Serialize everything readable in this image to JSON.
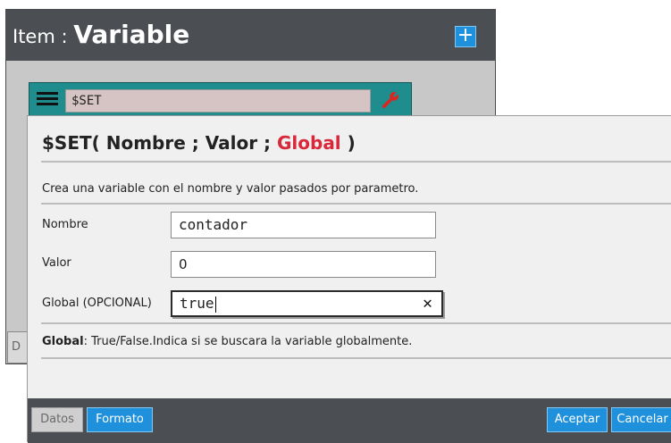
{
  "item_panel": {
    "title_prefix": "Item",
    "title_separator": " : ",
    "title_name": "Variable",
    "add_button_label": "+",
    "row_field_value": "$SET",
    "left_stub_label": "D"
  },
  "dialog": {
    "title_function": "$SET( Nombre ; Valor ; ",
    "title_global": "Global",
    "title_close": " )",
    "description": "Crea una variable con el nombre y valor pasados por parametro.",
    "fields": [
      {
        "label": "Nombre",
        "value": "contador"
      },
      {
        "label": "Valor",
        "value": "0"
      },
      {
        "label": "Global (OPCIONAL)",
        "value": "true"
      }
    ],
    "clear_symbol": "✕",
    "help_term": "Global",
    "help_text": ": True/False.Indica si se buscara la variable globalmente."
  },
  "footer": {
    "datos_label": "Datos",
    "formato_label": "Formato",
    "aceptar_label": "Aceptar",
    "cancelar_label": "Cancelar"
  },
  "colors": {
    "header_bg": "#4b4e53",
    "accent_blue": "#1e90dc",
    "global_red": "#d9283a",
    "row_teal": "#1f8c8e"
  }
}
